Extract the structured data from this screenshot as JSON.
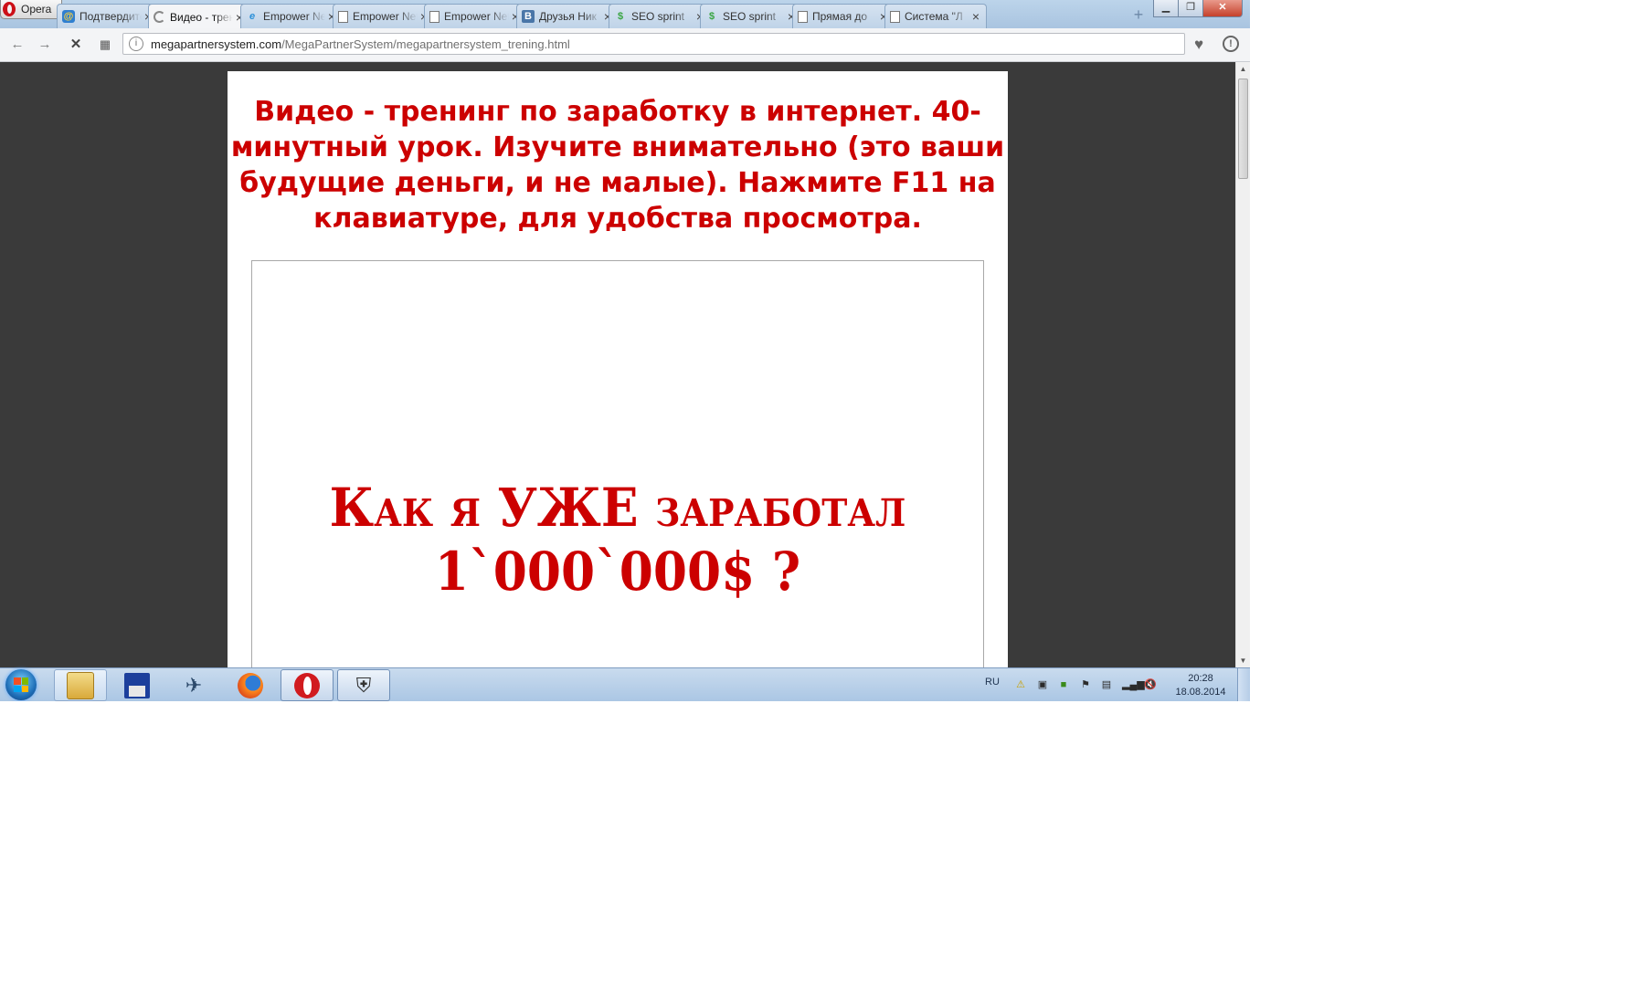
{
  "browser": {
    "menu_label": "Opera",
    "tabs": [
      {
        "label": "Подтвердите",
        "icon": "mail-icon",
        "active": false
      },
      {
        "label": "Видео - тренинг",
        "icon": "loading-icon",
        "active": true
      },
      {
        "label": "Empower Network",
        "icon": "empower-icon",
        "active": false
      },
      {
        "label": "Empower Network",
        "icon": "page-icon",
        "active": false
      },
      {
        "label": "Empower Network",
        "icon": "page-icon",
        "active": false
      },
      {
        "label": "Друзья Ник",
        "icon": "vk-icon",
        "active": false
      },
      {
        "label": "SEO sprint",
        "icon": "seosprint-icon",
        "active": false
      },
      {
        "label": "SEO sprint",
        "icon": "seosprint-icon",
        "active": false
      },
      {
        "label": "Прямая до",
        "icon": "page-icon",
        "active": false
      },
      {
        "label": "Система \"Л",
        "icon": "page-icon",
        "active": false
      }
    ],
    "address": {
      "host": "megapartnersystem.com",
      "path": "/MegaPartnerSystem/megapartnersystem_trening.html"
    }
  },
  "page": {
    "headline": "Видео - тренинг по заработку в интернет. 40-минутный урок. Изучите внимательно (это ваши будущие деньги, и не малые). Нажмите F11 на клавиатуре, для удобства просмотра.",
    "video_promo_line1": "Как я УЖЕ заработал",
    "video_promo_line2": "1`000`000$ ?",
    "accent_color": "#cc0000"
  },
  "taskbar": {
    "apps": [
      "folder-icon",
      "floppy-save-icon",
      "wings-icon",
      "firefox-icon",
      "opera-icon",
      "world-of-tanks-icon"
    ],
    "language": "RU",
    "time": "20:28",
    "date": "18.08.2014"
  }
}
